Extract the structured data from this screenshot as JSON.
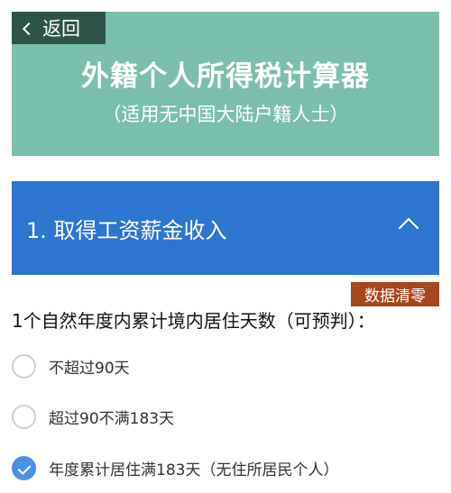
{
  "header": {
    "back_label": "返回",
    "title": "外籍个人所得税计算器",
    "subtitle": "（适用无中国大陆户籍人士）"
  },
  "section": {
    "title": "1. 取得工资薪金收入"
  },
  "clear_button": "数据清零",
  "question": "1个自然年度内累计境内居住天数（可预判）：",
  "options": [
    {
      "label": "不超过90天",
      "checked": false
    },
    {
      "label": "超过90不满183天",
      "checked": false
    },
    {
      "label": "年度累计居住满183天（无住所居民个人）",
      "checked": true
    }
  ],
  "colors": {
    "header_bg": "#79bfac",
    "back_bg": "#2d5449",
    "section_bg": "#2d75cf",
    "clear_bg": "#a8461c",
    "radio_checked": "#4a90e2"
  }
}
